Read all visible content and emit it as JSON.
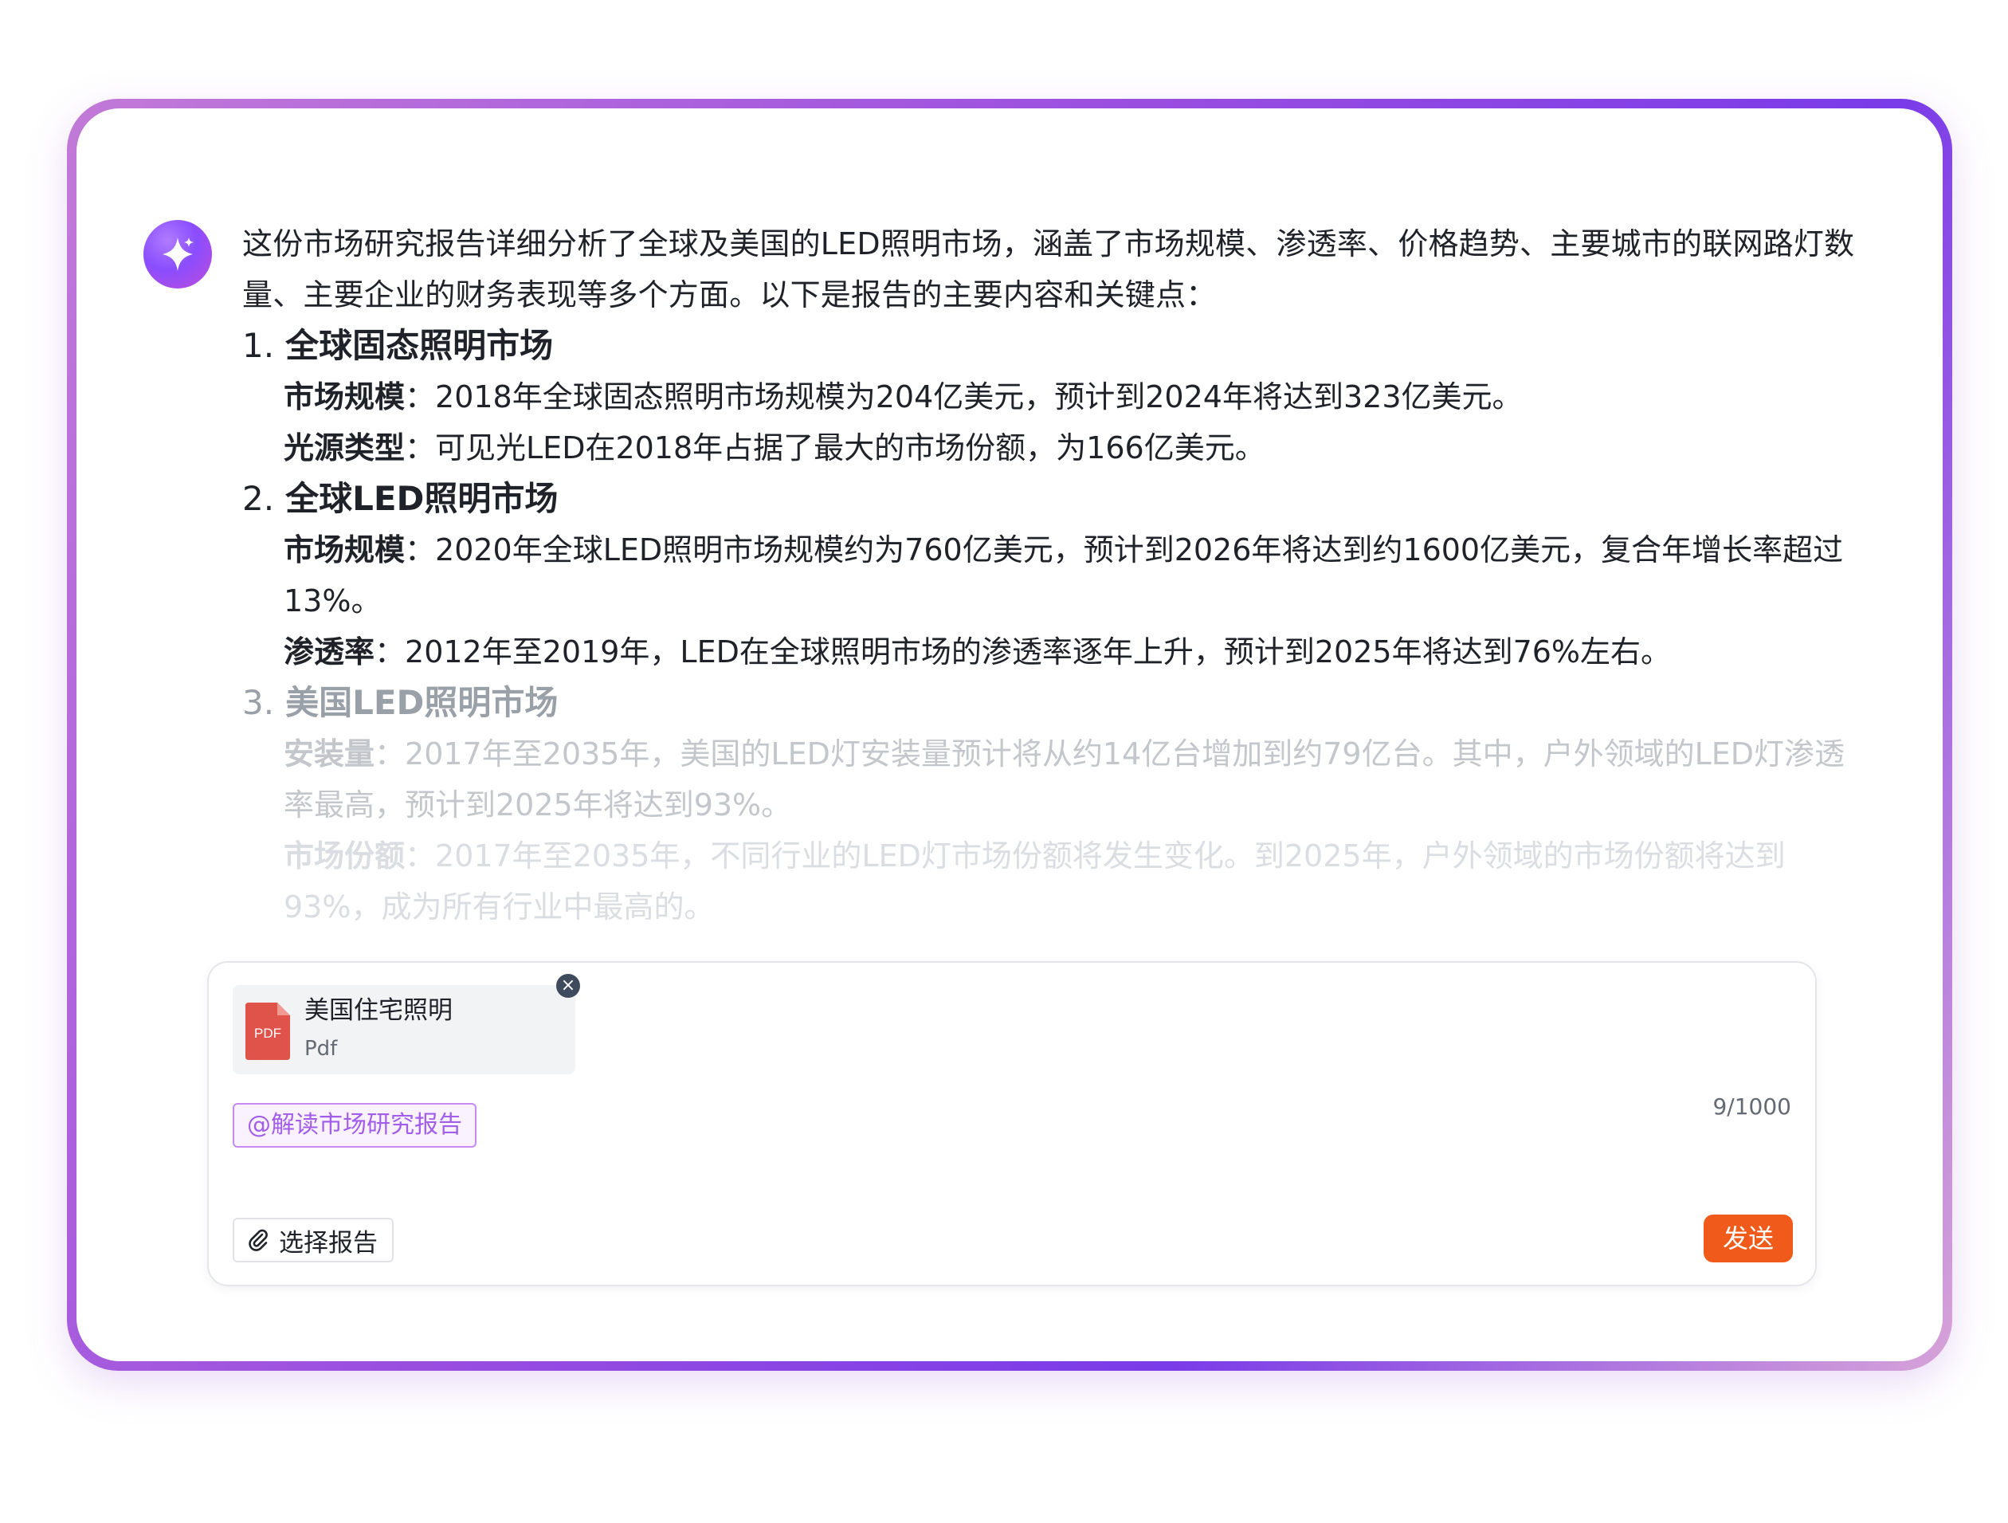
{
  "message": {
    "intro": "这份市场研究报告详细分析了全球及美国的LED照明市场，涵盖了市场规模、渗透率、价格趋势、主要城市的联网路灯数量、主要企业的财务表现等多个方面。以下是报告的主要内容和关键点：",
    "sections": [
      {
        "num": "1.",
        "title": "全球固态照明市场",
        "items": [
          {
            "label": "市场规模",
            "text": "：2018年全球固态照明市场规模为204亿美元，预计到2024年将达到323亿美元。"
          },
          {
            "label": "光源类型",
            "text": "：可见光LED在2018年占据了最大的市场份额，为166亿美元。"
          }
        ]
      },
      {
        "num": "2.",
        "title": "全球LED照明市场",
        "items": [
          {
            "label": "市场规模",
            "text": "：2020年全球LED照明市场规模约为760亿美元，预计到2026年将达到约1600亿美元，复合年增长率超过13%。"
          },
          {
            "label": "渗透率",
            "text": "：2012年至2019年，LED在全球照明市场的渗透率逐年上升，预计到2025年将达到76%左右。"
          }
        ]
      },
      {
        "num": "3.",
        "title": "美国LED照明市场",
        "items": [
          {
            "label": "安装量",
            "text": "：2017年至2035年，美国的LED灯安装量预计将从约14亿台增加到约79亿台。其中，户外领域的LED灯渗透率最高，预计到2025年将达到93%。"
          },
          {
            "label": "市场份额",
            "text": "：2017年至2035年，不同行业的LED灯市场份额将发生变化。到2025年，户外领域的市场份额将达到93%，成为所有行业中最高的。"
          }
        ]
      }
    ]
  },
  "input": {
    "file_name": "美国住宅照明",
    "file_type": "Pdf",
    "file_icon_text": "PDF",
    "close_symbol": "×",
    "tag": "@解读市场研究报告",
    "counter": "9/1000",
    "attach_label": "选择报告",
    "send_label": "发送"
  },
  "colors": {
    "accent_purple": "#8a4dff",
    "tag_purple": "#a25ee8",
    "send_orange": "#f05a1a",
    "pdf_red": "#e0534a"
  }
}
